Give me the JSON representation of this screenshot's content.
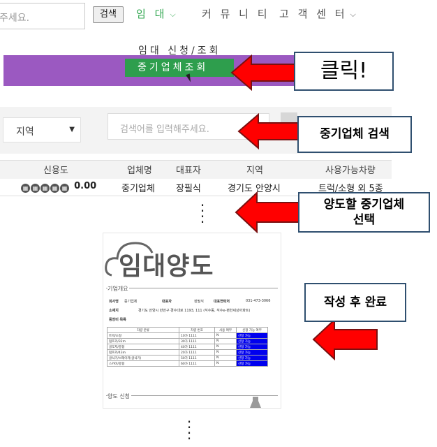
{
  "header": {
    "search_placeholder": "주세요.",
    "search_button": "검색",
    "nav": [
      {
        "label": "임 대",
        "has_dropdown": true,
        "active": true
      },
      {
        "label": "커 뮤 니 티",
        "has_dropdown": false,
        "active": false
      },
      {
        "label": "고 객 센 터",
        "has_dropdown": true,
        "active": false
      }
    ],
    "dropdown": {
      "items": [
        "임대 신청/조회",
        "중기업체조회"
      ],
      "highlighted": "중기업체조회"
    }
  },
  "callouts": {
    "click": "클릭!",
    "search": "중기업체 검색",
    "select": "양도할 중기업체\n선택",
    "complete": "작성 후 완료"
  },
  "search_panel": {
    "region_label": "지역",
    "keyword_placeholder": "검색어를 입력해주세요.",
    "button_fragment": "색"
  },
  "table": {
    "headers": [
      "신용도",
      "업체명",
      "대표자",
      "지역",
      "사용가능차량"
    ],
    "rows": [
      {
        "rating_score": "0.00",
        "company": "중기업체",
        "ceo": "장필식",
        "region": "경기도 안양시",
        "vehicles": "트럭/소형 외 5종"
      }
    ]
  },
  "document": {
    "logo": "임대양도",
    "section1": "기업개요",
    "company_label": "회사명",
    "company": "중기업체",
    "ceo_label": "대표자",
    "ceo": "장필식",
    "phone_label": "대표연락처",
    "phone": "031-473-3066",
    "address_label": "소재지",
    "address": "경기도 안양시 만안구 경수대로 1193, 111 (석수동, 석수e-편한세상아파트)",
    "equipment_label": "중장비 목록",
    "equip_headers": [
      "차량 분류",
      "차량 번호",
      "사용 여부",
      "신청 가능 여부"
    ],
    "equipment": [
      {
        "type": "트럭/소형",
        "number": "10가 1111",
        "used": "N",
        "status": "신청 가능"
      },
      {
        "type": "펌프카/32m",
        "number": "30가 1111",
        "used": "N",
        "status": "신청 가능"
      },
      {
        "type": "굴도저/중형",
        "number": "40가 1111",
        "used": "N",
        "status": "신청 가능"
      },
      {
        "type": "펌프카/43m",
        "number": "20가 1111",
        "used": "N",
        "status": "신청 가능"
      },
      {
        "type": "굴삭기/브레이커(굴삭기)",
        "number": "50가 1111",
        "used": "N",
        "status": "신청 가능"
      },
      {
        "type": "스카이/중형",
        "number": "60가 1111",
        "used": "N",
        "status": "신청 가능"
      }
    ],
    "section2": "양도 신청"
  },
  "colors": {
    "nav_active": "#35a853",
    "menu_highlight": "#2e9e4d",
    "band": "#9b59c1",
    "arrow": "#ff0000",
    "callout_border": "#2f4f6f"
  }
}
